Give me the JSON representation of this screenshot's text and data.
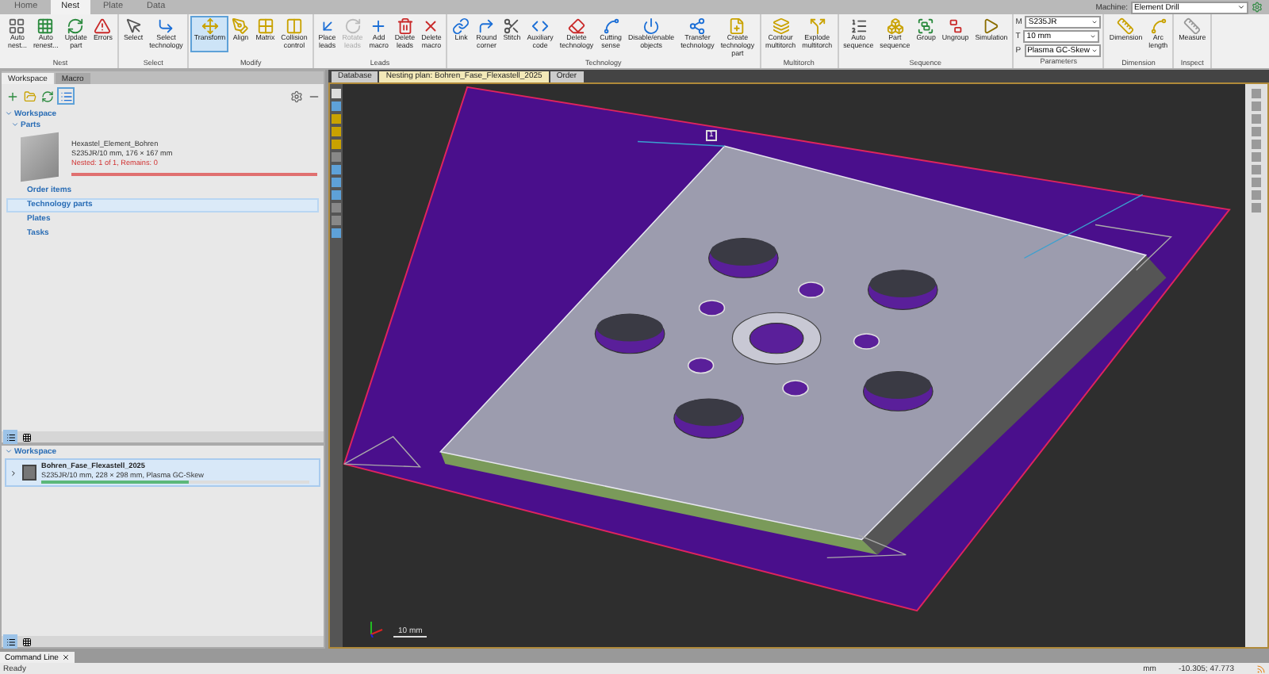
{
  "menu_tabs": [
    {
      "label": "Home",
      "selected": false
    },
    {
      "label": "Nest",
      "selected": true
    },
    {
      "label": "Plate",
      "selected": false
    },
    {
      "label": "Data",
      "selected": false
    }
  ],
  "machine": {
    "label": "Machine:",
    "value": "Element Drill"
  },
  "ribbon": [
    {
      "label": "Nest",
      "kind": "buttons",
      "buttons": [
        {
          "label": "Auto nest...",
          "selected": false,
          "disabled": false
        },
        {
          "label": "Auto renest...",
          "selected": false,
          "disabled": false
        },
        {
          "label": "Update part",
          "selected": false,
          "disabled": false
        },
        {
          "label": "Errors",
          "selected": false,
          "disabled": false
        }
      ]
    },
    {
      "label": "Select",
      "kind": "buttons",
      "buttons": [
        {
          "label": "Select",
          "selected": false,
          "disabled": false
        },
        {
          "label": "Select technology",
          "selected": false,
          "disabled": false
        }
      ]
    },
    {
      "label": "Modify",
      "kind": "buttons",
      "buttons": [
        {
          "label": "Transform",
          "selected": true,
          "disabled": false
        },
        {
          "label": "Align",
          "selected": false,
          "disabled": false
        },
        {
          "label": "Matrix",
          "selected": false,
          "disabled": false
        },
        {
          "label": "Collision control",
          "selected": false,
          "disabled": false
        }
      ]
    },
    {
      "label": "Leads",
      "kind": "buttons",
      "buttons": [
        {
          "label": "Place leads",
          "selected": false,
          "disabled": false
        },
        {
          "label": "Rotate leads",
          "selected": false,
          "disabled": true
        },
        {
          "label": "Add macro",
          "selected": false,
          "disabled": false
        },
        {
          "label": "Delete leads",
          "selected": false,
          "disabled": false
        },
        {
          "label": "Delete macro",
          "selected": false,
          "disabled": false
        }
      ]
    },
    {
      "label": "Technology",
      "kind": "buttons",
      "buttons": [
        {
          "label": "Link",
          "selected": false,
          "disabled": false
        },
        {
          "label": "Round corner",
          "selected": false,
          "disabled": false
        },
        {
          "label": "Stitch",
          "selected": false,
          "disabled": false
        },
        {
          "label": "Auxiliary code",
          "selected": false,
          "disabled": false
        },
        {
          "label": "Delete technology",
          "selected": false,
          "disabled": false
        },
        {
          "label": "Cutting sense",
          "selected": false,
          "disabled": false
        },
        {
          "label": "Disable/enable objects",
          "selected": false,
          "disabled": false
        },
        {
          "label": "Transfer technology",
          "selected": false,
          "disabled": false
        },
        {
          "label": "Create technology part",
          "selected": false,
          "disabled": false
        }
      ]
    },
    {
      "label": "Multitorch",
      "kind": "buttons",
      "buttons": [
        {
          "label": "Contour multitorch",
          "selected": false,
          "disabled": false
        },
        {
          "label": "Explode multitorch",
          "selected": false,
          "disabled": false
        }
      ]
    },
    {
      "label": "Sequence",
      "kind": "buttons",
      "buttons": [
        {
          "label": "Auto sequence",
          "selected": false,
          "disabled": false
        },
        {
          "label": "Part sequence",
          "selected": false,
          "disabled": false
        },
        {
          "label": "Group",
          "selected": false,
          "disabled": false
        },
        {
          "label": "Ungroup",
          "selected": false,
          "disabled": false
        },
        {
          "label": "Simulation",
          "selected": false,
          "disabled": false
        }
      ]
    },
    {
      "label": "Parameters",
      "kind": "fields",
      "fields": [
        {
          "prefix": "M",
          "value": "S235JR"
        },
        {
          "prefix": "T",
          "value": "10 mm"
        },
        {
          "prefix": "P",
          "value": "Plasma GC-Skew"
        }
      ]
    },
    {
      "label": "Dimension",
      "kind": "buttons",
      "buttons": [
        {
          "label": "Dimension",
          "selected": false,
          "disabled": false
        },
        {
          "label": "Arc length",
          "selected": false,
          "disabled": false
        }
      ]
    },
    {
      "label": "Inspect",
      "kind": "buttons",
      "buttons": [
        {
          "label": "Measure",
          "selected": false,
          "disabled": false
        }
      ]
    }
  ],
  "left_tabs": [
    {
      "label": "Workspace",
      "selected": true
    },
    {
      "label": "Macro",
      "selected": false
    }
  ],
  "tree": {
    "label": "Workspace",
    "expanded": true,
    "children": [
      {
        "label": "Parts",
        "expanded": true,
        "selected": false,
        "part": {
          "name": "Hexastel_Element_Bohren",
          "info": "S235JR/10 mm, 176 × 167 mm",
          "status": "Nested: 1 of 1, Remains: 0",
          "level": 1
        }
      },
      {
        "label": "Order items",
        "selected": false
      },
      {
        "label": "Technology parts",
        "selected": true
      },
      {
        "label": "Plates",
        "selected": false
      },
      {
        "label": "Tasks",
        "selected": false
      }
    ]
  },
  "plans": {
    "label": "Workspace",
    "expanded": true,
    "items": [
      {
        "name": "Bohren_Fase_Flexastell_2025",
        "info": "S235JR/10 mm, 228 × 298 mm, Plasma GC-Skew",
        "selected": true,
        "expanded": false,
        "level": 0.55
      }
    ]
  },
  "view_tabs": [
    {
      "label": "Database",
      "selected": false
    },
    {
      "label": "Nesting plan: Bohren_Fase_Flexastell_2025",
      "selected": true
    },
    {
      "label": "Order",
      "selected": false
    }
  ],
  "viewport": {
    "marker": "1",
    "scale": "10 mm"
  },
  "command_tab": "Command Line",
  "status_bar": {
    "state": "Ready",
    "unit": "mm",
    "coords": "-10.305; 47.773"
  }
}
